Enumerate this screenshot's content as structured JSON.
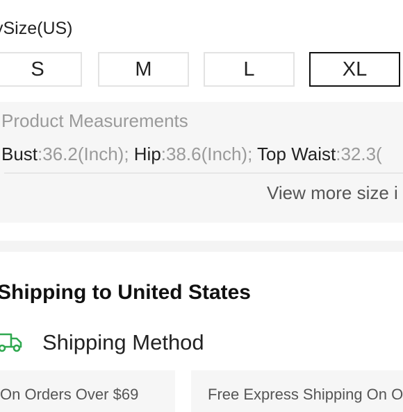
{
  "size_selector": {
    "title": "ySize(US)",
    "options": [
      "S",
      "M",
      "L",
      "XL"
    ],
    "selected": "XL"
  },
  "measurements": {
    "title": "Product Measurements",
    "items": [
      {
        "label": "Bust",
        "value": ":36.2(Inch); "
      },
      {
        "label": "Hip",
        "value": ":38.6(Inch); "
      },
      {
        "label": "Top Waist",
        "value": ":32.3("
      }
    ],
    "view_more": "View more size i"
  },
  "shipping": {
    "title": "Shipping to United States",
    "method_label": "Shipping Method",
    "icon": "truck-icon",
    "cards": [
      "On Orders Over $69",
      "Free Express Shipping On O"
    ]
  },
  "colors": {
    "accent_green": "#2fa84f",
    "selected_border": "#111111",
    "panel_bg": "#f6f6f6"
  }
}
